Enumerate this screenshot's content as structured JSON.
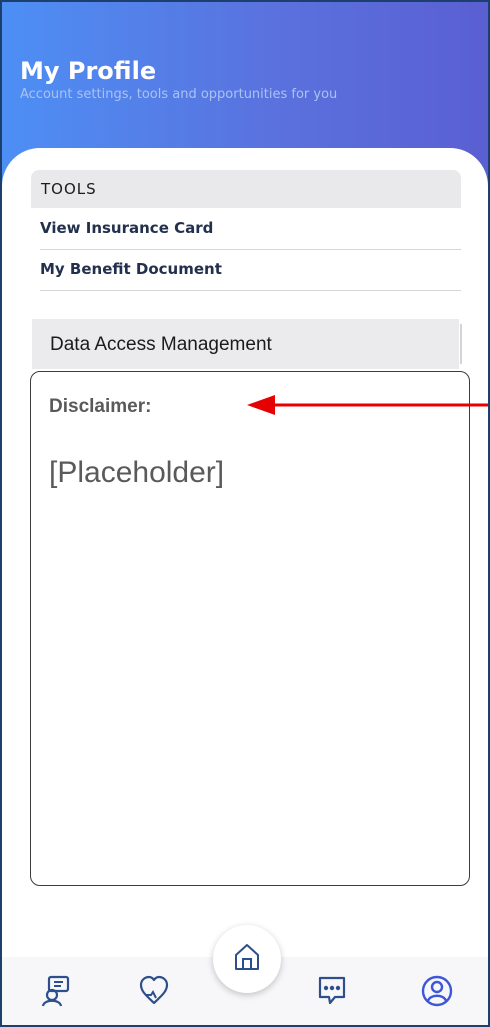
{
  "header": {
    "title": "My Profile",
    "subtitle": "Account settings, tools and opportunities for you"
  },
  "tools": {
    "heading": "TOOLS",
    "items": [
      {
        "label": "View Insurance Card"
      },
      {
        "label": "My Benefit Document"
      }
    ]
  },
  "data_access": {
    "heading": "Data Access Management",
    "disclaimer_label": "Disclaimer:",
    "placeholder": "[Placeholder]"
  },
  "tabbar": {
    "items": [
      {
        "icon": "care-team-icon"
      },
      {
        "icon": "heart-health-icon"
      },
      {
        "icon": "home-icon",
        "raised": true
      },
      {
        "icon": "chat-bubble-icon"
      },
      {
        "icon": "profile-icon",
        "active": true
      }
    ]
  },
  "colors": {
    "header_gradient_start": "#4d8ff5",
    "header_gradient_end": "#5a5fd2",
    "annotation_arrow": "#e60000",
    "tab_icon": "#2d4f8c",
    "tab_active": "#3e57d8"
  }
}
